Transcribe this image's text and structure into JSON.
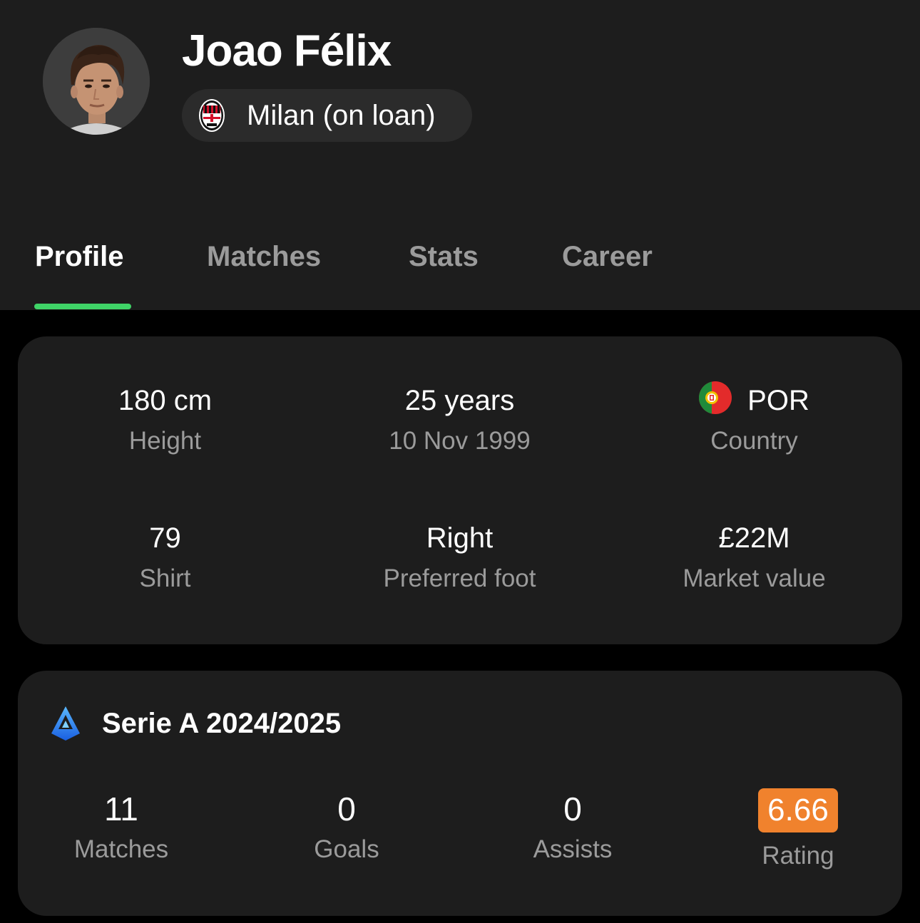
{
  "player": {
    "name": "Joao Félix",
    "team": "Milan (on loan)"
  },
  "tabs": [
    {
      "label": "Profile",
      "active": true
    },
    {
      "label": "Matches",
      "active": false
    },
    {
      "label": "Stats",
      "active": false
    },
    {
      "label": "Career",
      "active": false
    }
  ],
  "info": {
    "height": {
      "value": "180 cm",
      "label": "Height"
    },
    "age": {
      "value": "25 years",
      "label": "10 Nov 1999"
    },
    "country": {
      "value": "POR",
      "label": "Country",
      "flag_icon": "portugal-flag-icon"
    },
    "shirt": {
      "value": "79",
      "label": "Shirt"
    },
    "foot": {
      "value": "Right",
      "label": "Preferred foot"
    },
    "market": {
      "value": "£22M",
      "label": "Market value"
    }
  },
  "season": {
    "title": "Serie A 2024/2025",
    "league_icon": "serie-a-logo-icon",
    "stats": {
      "matches": {
        "value": "11",
        "label": "Matches"
      },
      "goals": {
        "value": "0",
        "label": "Goals"
      },
      "assists": {
        "value": "0",
        "label": "Assists"
      },
      "rating": {
        "value": "6.66",
        "label": "Rating",
        "color": "#f0822d"
      }
    }
  },
  "colors": {
    "accent": "#3fd467",
    "card": "#1d1d1d",
    "muted_text": "#9b9b9b"
  }
}
